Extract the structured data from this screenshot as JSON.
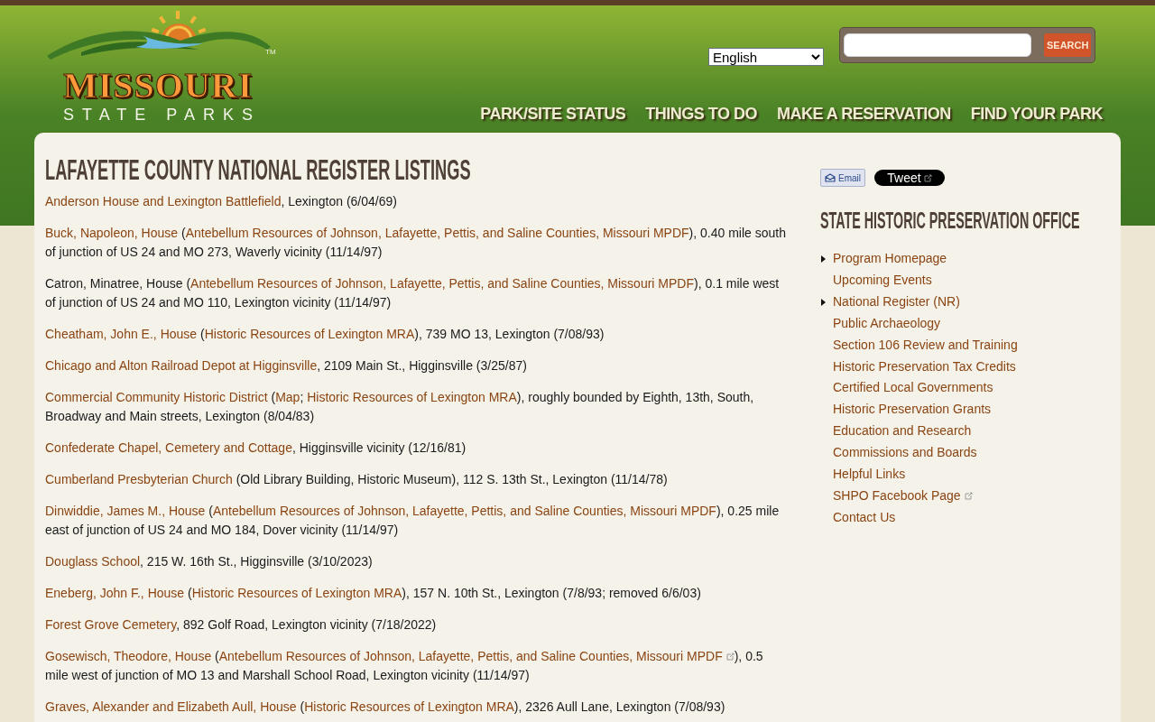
{
  "logo": {
    "name": "MISSOURI",
    "tagline": "STATE PARKS",
    "mark": "TM"
  },
  "language_select": {
    "value": "English"
  },
  "search": {
    "button": "SEARCH"
  },
  "nav": [
    "PARK/SITE STATUS",
    "THINGS TO DO",
    "MAKE A RESERVATION",
    "FIND YOUR PARK"
  ],
  "heading": "LAFAYETTE COUNTY NATIONAL REGISTER LISTINGS",
  "listings": [
    [
      {
        "kind": "link",
        "text": "Anderson House and Lexington Battlefield"
      },
      {
        "kind": "text",
        "text": ", Lexington (6/04/69)"
      }
    ],
    [
      {
        "kind": "link",
        "text": "Buck, Napoleon, House"
      },
      {
        "kind": "text",
        "text": " ("
      },
      {
        "kind": "link",
        "text": "Antebellum Resources of Johnson, Lafayette, Pettis, and Saline Counties, Missouri MPDF"
      },
      {
        "kind": "text",
        "text": "), 0.40 mile south of junction of US 24 and MO 273, Waverly vicinity (11/14/97)"
      }
    ],
    [
      {
        "kind": "text",
        "text": "Catron, Minatree, House ("
      },
      {
        "kind": "link",
        "text": "Antebellum Resources of Johnson, Lafayette, Pettis, and Saline Counties, Missouri MPDF"
      },
      {
        "kind": "text",
        "text": "), 0.1 mile west of junction of US 24 and MO 110, Lexington vicinity (11/14/97)"
      }
    ],
    [
      {
        "kind": "link",
        "text": "Cheatham, John E., House"
      },
      {
        "kind": "text",
        "text": " ("
      },
      {
        "kind": "link",
        "text": "Historic Resources of Lexington MRA"
      },
      {
        "kind": "text",
        "text": "), 739 MO 13, Lexington (7/08/93)"
      }
    ],
    [
      {
        "kind": "link",
        "text": "Chicago and Alton Railroad Depot at Higginsville"
      },
      {
        "kind": "text",
        "text": ", 2109 Main St., Higginsville (3/25/87)"
      }
    ],
    [
      {
        "kind": "link",
        "text": "Commercial Community Historic District"
      },
      {
        "kind": "text",
        "text": " ("
      },
      {
        "kind": "link",
        "text": "Map"
      },
      {
        "kind": "text",
        "text": "; "
      },
      {
        "kind": "link",
        "text": "Historic Resources of Lexington MRA"
      },
      {
        "kind": "text",
        "text": "), roughly bounded by Eighth, 13th, South, Broadway and Main streets, Lexington (8/04/83)"
      }
    ],
    [
      {
        "kind": "link",
        "text": "Confederate Chapel, Cemetery and Cottage"
      },
      {
        "kind": "text",
        "text": ", Higginsville vicinity (12/16/81)"
      }
    ],
    [
      {
        "kind": "link",
        "text": "Cumberland Presbyterian Church"
      },
      {
        "kind": "text",
        "text": " (Old Library Building, Historic Museum), 112 S. 13th St., Lexington (11/14/78)"
      }
    ],
    [
      {
        "kind": "link",
        "text": "Dinwiddie, James M., House"
      },
      {
        "kind": "text",
        "text": " ("
      },
      {
        "kind": "link",
        "text": "Antebellum Resources of Johnson, Lafayette, Pettis, and Saline Counties, Missouri MPDF"
      },
      {
        "kind": "text",
        "text": "), 0.25 mile east of junction of US 24 and MO 184, Dover vicinity (11/14/97)"
      }
    ],
    [
      {
        "kind": "link",
        "text": "Douglass School"
      },
      {
        "kind": "text",
        "text": ", 215 W. 16th St., Higginsville (3/10/2023)"
      }
    ],
    [
      {
        "kind": "link",
        "text": "Eneberg, John F., House"
      },
      {
        "kind": "text",
        "text": " ("
      },
      {
        "kind": "link",
        "text": "Historic Resources of Lexington MRA"
      },
      {
        "kind": "text",
        "text": "), 157 N. 10th St., Lexington (7/8/93; removed 6/6/03)"
      }
    ],
    [
      {
        "kind": "link",
        "text": "Forest Grove Cemetery"
      },
      {
        "kind": "text",
        "text": ", 892 Golf Road, Lexington vicinity (7/18/2022)"
      }
    ],
    [
      {
        "kind": "link",
        "text": "Gosewisch, Theodore, House"
      },
      {
        "kind": "text",
        "text": " ("
      },
      {
        "kind": "external_link",
        "text": "Antebellum Resources of Johnson, Lafayette, Pettis, and Saline Counties, Missouri MPDF"
      },
      {
        "kind": "text",
        "text": "), 0.5 mile west of junction of MO 13 and Marshall School Road, Lexington vicinity (11/14/97)"
      }
    ],
    [
      {
        "kind": "link",
        "text": "Graves, Alexander and Elizabeth Aull, House"
      },
      {
        "kind": "text",
        "text": " ("
      },
      {
        "kind": "link",
        "text": "Historic Resources of Lexington MRA"
      },
      {
        "kind": "text",
        "text": "), 2326 Aull Lane, Lexington (7/08/93)"
      }
    ]
  ],
  "share": {
    "email": "Email",
    "tweet": "Tweet"
  },
  "sidebar": {
    "heading": "STATE HISTORIC PRESERVATION OFFICE",
    "items": [
      {
        "label": "Program Homepage",
        "has_children": true,
        "external": false
      },
      {
        "label": "Upcoming Events",
        "has_children": false,
        "external": false
      },
      {
        "label": "National Register (NR)",
        "has_children": true,
        "external": false
      },
      {
        "label": "Public Archaeology",
        "has_children": false,
        "external": false
      },
      {
        "label": "Section 106 Review and Training",
        "has_children": false,
        "external": false
      },
      {
        "label": "Historic Preservation Tax Credits",
        "has_children": false,
        "external": false
      },
      {
        "label": "Certified Local Governments",
        "has_children": false,
        "external": false
      },
      {
        "label": "Historic Preservation Grants",
        "has_children": false,
        "external": false
      },
      {
        "label": "Education and Research",
        "has_children": false,
        "external": false
      },
      {
        "label": "Commissions and Boards",
        "has_children": false,
        "external": false
      },
      {
        "label": "Helpful Links",
        "has_children": false,
        "external": false
      },
      {
        "label": "SHPO Facebook Page",
        "has_children": false,
        "external": true
      },
      {
        "label": "Contact Us",
        "has_children": false,
        "external": false
      }
    ]
  }
}
